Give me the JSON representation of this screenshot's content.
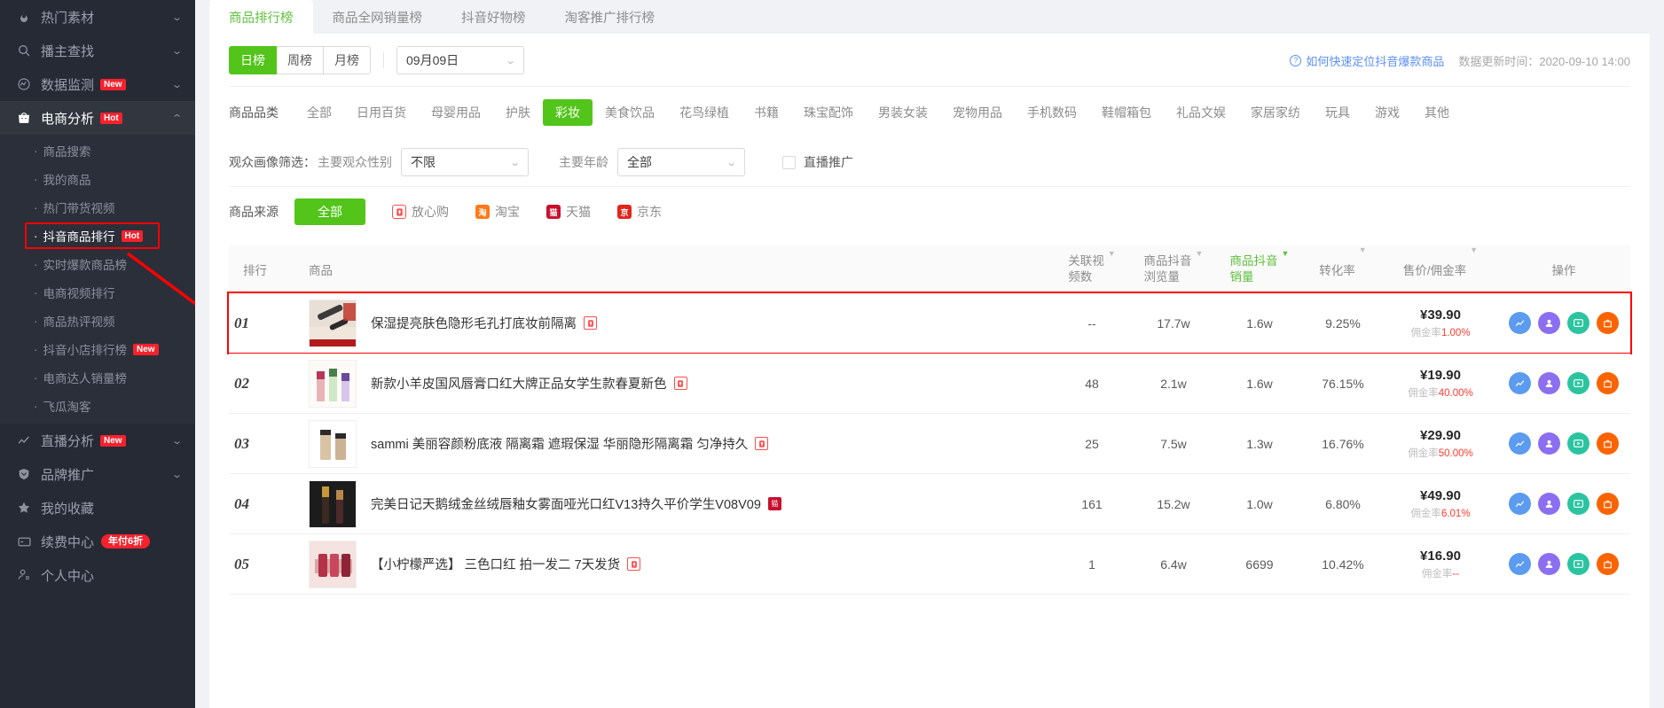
{
  "sidebar": {
    "items": [
      {
        "label": "热门素材",
        "icon": "fire-icon",
        "expandable": true,
        "badge": ""
      },
      {
        "label": "播主查找",
        "icon": "search-icon",
        "expandable": true,
        "badge": ""
      },
      {
        "label": "数据监测",
        "icon": "monitor-icon",
        "expandable": true,
        "badge": "New"
      },
      {
        "label": "电商分析",
        "icon": "bag-icon",
        "expandable": true,
        "badge": "Hot",
        "active": true
      }
    ],
    "submenu": [
      {
        "label": "商品搜索"
      },
      {
        "label": "我的商品"
      },
      {
        "label": "热门带货视频"
      },
      {
        "label": "抖音商品排行",
        "badge": "Hot",
        "selected": true
      },
      {
        "label": "实时爆款商品榜"
      },
      {
        "label": "电商视频排行"
      },
      {
        "label": "商品热评视频"
      },
      {
        "label": "抖音小店排行榜",
        "badge": "New"
      },
      {
        "label": "电商达人销量榜"
      },
      {
        "label": "飞瓜淘客"
      }
    ],
    "bottom": [
      {
        "label": "直播分析",
        "icon": "chart-line-icon",
        "expandable": true,
        "badge": "New"
      },
      {
        "label": "品牌推广",
        "icon": "shield-icon",
        "expandable": true,
        "badge": ""
      },
      {
        "label": "我的收藏",
        "icon": "star-icon",
        "expandable": false,
        "badge": ""
      },
      {
        "label": "续费中心",
        "icon": "card-icon",
        "expandable": false,
        "pill": "年付6折"
      },
      {
        "label": "个人中心",
        "icon": "user-icon",
        "expandable": false,
        "badge": ""
      }
    ]
  },
  "tabs": [
    {
      "label": "商品排行榜",
      "active": true
    },
    {
      "label": "商品全网销量榜",
      "active": false
    },
    {
      "label": "抖音好物榜",
      "active": false
    },
    {
      "label": "淘客推广排行榜",
      "active": false
    }
  ],
  "filters": {
    "period": [
      {
        "label": "日榜",
        "on": true
      },
      {
        "label": "周榜",
        "on": false
      },
      {
        "label": "月榜",
        "on": false
      }
    ],
    "date_value": "09月09日",
    "help_link": "如何快速定位抖音爆款商品",
    "update_time": "数据更新时间：2020-09-10 14:00",
    "category_label": "商品品类",
    "categories": [
      {
        "label": "全部",
        "on": false
      },
      {
        "label": "日用百货",
        "on": false
      },
      {
        "label": "母婴用品",
        "on": false
      },
      {
        "label": "护肤",
        "on": false
      },
      {
        "label": "彩妆",
        "on": true
      },
      {
        "label": "美食饮品",
        "on": false
      },
      {
        "label": "花鸟绿植",
        "on": false
      },
      {
        "label": "书籍",
        "on": false
      },
      {
        "label": "珠宝配饰",
        "on": false
      },
      {
        "label": "男装女装",
        "on": false
      },
      {
        "label": "宠物用品",
        "on": false
      },
      {
        "label": "手机数码",
        "on": false
      },
      {
        "label": "鞋帽箱包",
        "on": false
      },
      {
        "label": "礼品文娱",
        "on": false
      },
      {
        "label": "家居家纺",
        "on": false
      },
      {
        "label": "玩具",
        "on": false
      },
      {
        "label": "游戏",
        "on": false
      },
      {
        "label": "其他",
        "on": false
      }
    ],
    "audience_label": "观众画像筛选：",
    "gender_label": "主要观众性别",
    "gender_value": "不限",
    "age_label": "主要年龄",
    "age_value": "全部",
    "live_promo_label": "直播推广",
    "source_label": "商品来源",
    "source_all": "全部",
    "sources": [
      {
        "label": "放心购",
        "color": "#ff4d4f",
        "glyph": "放"
      },
      {
        "label": "淘宝",
        "color": "#ff7a18",
        "glyph": "淘"
      },
      {
        "label": "天猫",
        "color": "#c8102e",
        "glyph": "猫"
      },
      {
        "label": "京东",
        "color": "#e1251b",
        "glyph": "京"
      }
    ]
  },
  "table": {
    "columns": [
      {
        "key": "rank",
        "label": "排行",
        "sortable": false
      },
      {
        "key": "product",
        "label": "商品",
        "sortable": false
      },
      {
        "key": "video_count",
        "label_top": "关联视",
        "label_bottom": "频数",
        "sortable": true
      },
      {
        "key": "views",
        "label_top": "商品抖音",
        "label_bottom": "浏览量",
        "sortable": true
      },
      {
        "key": "sales",
        "label_top": "商品抖音",
        "label_bottom": "销量",
        "sortable": true,
        "active": true
      },
      {
        "key": "conversion",
        "label": "转化率",
        "sortable": true
      },
      {
        "key": "price",
        "label": "售价/佣金率",
        "sortable": true
      },
      {
        "key": "actions",
        "label": "操作",
        "sortable": false
      }
    ],
    "rows": [
      {
        "rank": "01",
        "name": "保湿提亮肤色隐形毛孔打底妆前隔离",
        "tag": "放心购",
        "video_count": "--",
        "views": "17.7w",
        "sales": "1.6w",
        "conversion": "9.25%",
        "price": "¥39.90",
        "commission_label": "佣金率",
        "commission": "1.00%",
        "highlighted": true,
        "thumb": "makeup-primer"
      },
      {
        "rank": "02",
        "name": "新款小羊皮国风唇膏口红大牌正品女学生款春夏新色",
        "tag": "放心购",
        "video_count": "48",
        "views": "2.1w",
        "sales": "1.6w",
        "conversion": "76.15%",
        "price": "¥19.90",
        "commission_label": "佣金率",
        "commission": "40.00%",
        "highlighted": false,
        "thumb": "lipstick-set"
      },
      {
        "rank": "03",
        "name": "sammi 美丽容颜粉底液 隔离霜 遮瑕保湿 华丽隐形隔离霜 匀净持久",
        "tag": "放心购",
        "video_count": "25",
        "views": "7.5w",
        "sales": "1.3w",
        "conversion": "16.76%",
        "price": "¥29.90",
        "commission_label": "佣金率",
        "commission": "50.00%",
        "highlighted": false,
        "thumb": "foundation-bottles"
      },
      {
        "rank": "04",
        "name": "完美日记天鹅绒金丝绒唇釉女雾面哑光口红V13持久平价学生V08V09",
        "tag": "天猫",
        "video_count": "161",
        "views": "15.2w",
        "sales": "1.0w",
        "conversion": "6.80%",
        "price": "¥49.90",
        "commission_label": "佣金率",
        "commission": "6.01%",
        "highlighted": false,
        "thumb": "lip-glaze"
      },
      {
        "rank": "05",
        "name": "【小柠檬严选】 三色口红 拍一发二 7天发货",
        "tag": "放心购",
        "video_count": "1",
        "views": "6.4w",
        "sales": "6699",
        "conversion": "10.42%",
        "price": "¥16.90",
        "commission_label": "佣金率",
        "commission": "--",
        "highlighted": false,
        "thumb": "three-lipsticks"
      }
    ],
    "actions": [
      {
        "name": "trend-chart-icon",
        "color": "#5b9bf0"
      },
      {
        "name": "audience-icon",
        "color": "#8b6ff0"
      },
      {
        "name": "video-play-icon",
        "color": "#2cc4a0"
      },
      {
        "name": "shop-icon",
        "color": "#fa6400"
      }
    ]
  },
  "colors": {
    "accent_green": "#52c41a",
    "tab_green": "#5fbf3d",
    "link_blue": "#5b8ff9",
    "highlight_red": "#ff0000",
    "sidebar_bg": "#262a35"
  }
}
